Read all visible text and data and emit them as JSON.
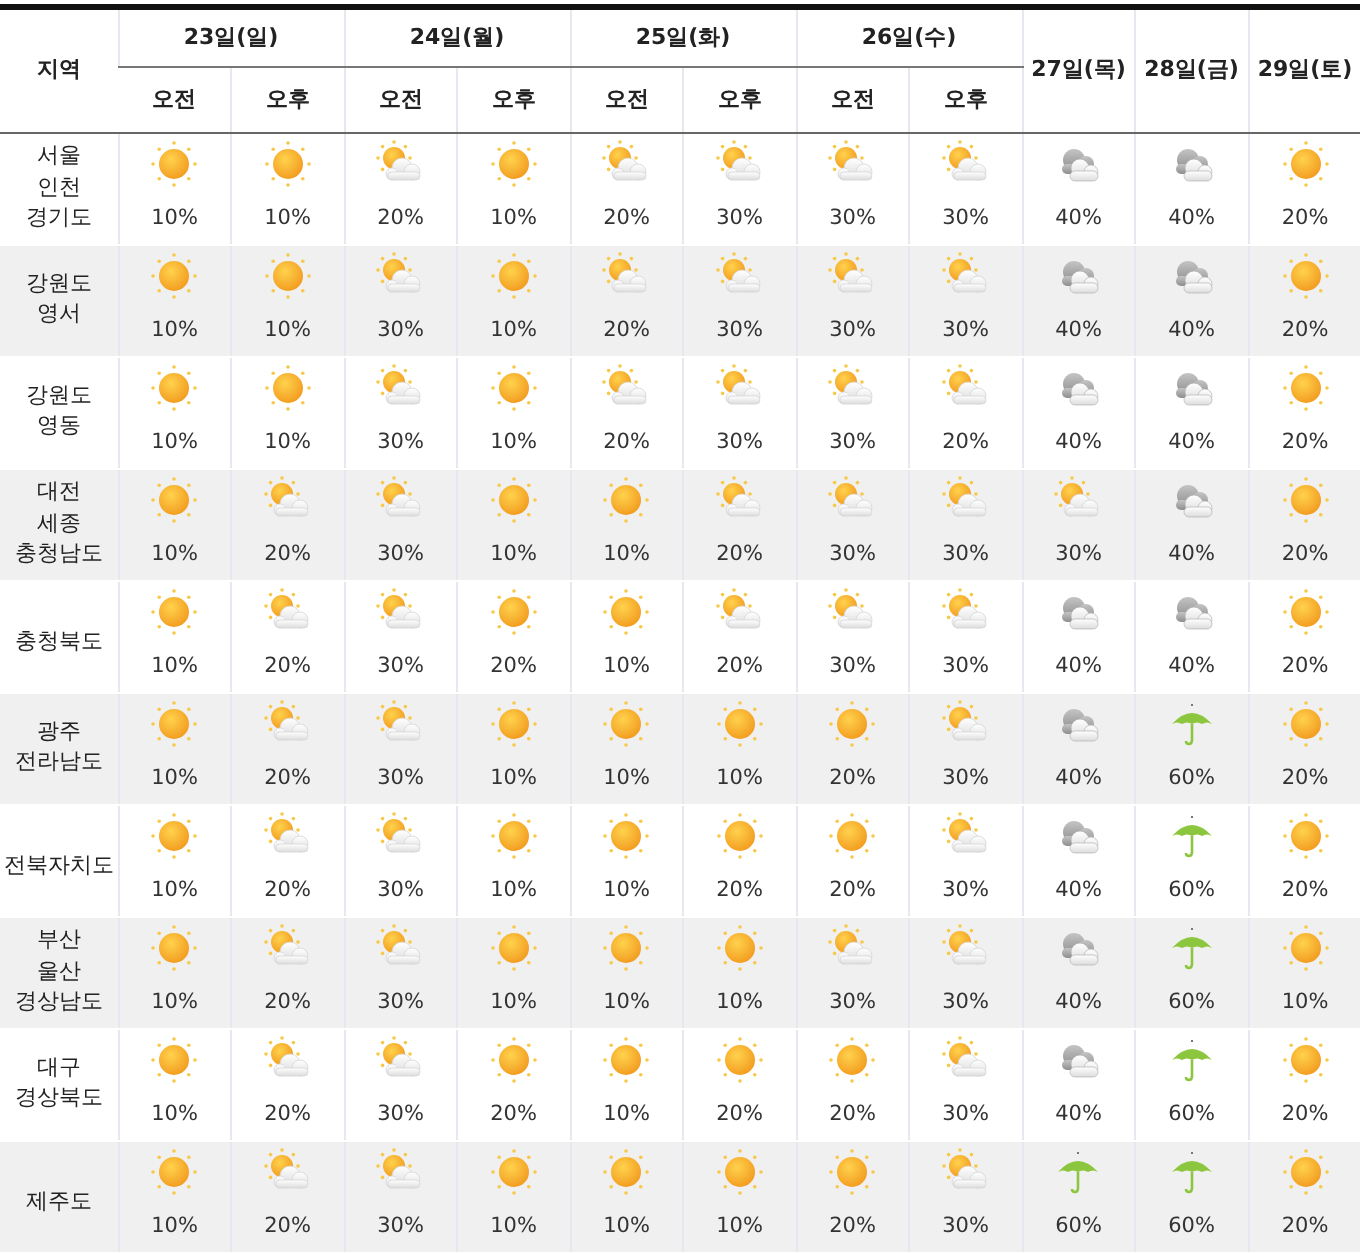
{
  "table": {
    "corner_header": "지역",
    "days": [
      {
        "label": "23일(일)",
        "periods": [
          "오전",
          "오후"
        ]
      },
      {
        "label": "24일(월)",
        "periods": [
          "오전",
          "오후"
        ]
      },
      {
        "label": "25일(화)",
        "periods": [
          "오전",
          "오후"
        ]
      },
      {
        "label": "26일(수)",
        "periods": [
          "오전",
          "오후"
        ]
      },
      {
        "label": "27일(목)"
      },
      {
        "label": "28일(금)"
      },
      {
        "label": "29일(토)"
      }
    ],
    "rows": [
      {
        "region": [
          "서울",
          "인천",
          "경기도"
        ],
        "forecasts": [
          {
            "kind": "sunny",
            "chance": "10%"
          },
          {
            "kind": "sunny",
            "chance": "10%"
          },
          {
            "kind": "partly_cloudy",
            "chance": "20%"
          },
          {
            "kind": "sunny",
            "chance": "10%"
          },
          {
            "kind": "partly_cloudy",
            "chance": "20%"
          },
          {
            "kind": "partly_cloudy",
            "chance": "30%"
          },
          {
            "kind": "partly_cloudy",
            "chance": "30%"
          },
          {
            "kind": "partly_cloudy",
            "chance": "30%"
          },
          {
            "kind": "cloudy",
            "chance": "40%"
          },
          {
            "kind": "cloudy",
            "chance": "40%"
          },
          {
            "kind": "sunny",
            "chance": "20%"
          }
        ]
      },
      {
        "region": [
          "강원도",
          "영서"
        ],
        "forecasts": [
          {
            "kind": "sunny",
            "chance": "10%"
          },
          {
            "kind": "sunny",
            "chance": "10%"
          },
          {
            "kind": "partly_cloudy",
            "chance": "30%"
          },
          {
            "kind": "sunny",
            "chance": "10%"
          },
          {
            "kind": "partly_cloudy",
            "chance": "20%"
          },
          {
            "kind": "partly_cloudy",
            "chance": "30%"
          },
          {
            "kind": "partly_cloudy",
            "chance": "30%"
          },
          {
            "kind": "partly_cloudy",
            "chance": "30%"
          },
          {
            "kind": "cloudy",
            "chance": "40%"
          },
          {
            "kind": "cloudy",
            "chance": "40%"
          },
          {
            "kind": "sunny",
            "chance": "20%"
          }
        ]
      },
      {
        "region": [
          "강원도",
          "영동"
        ],
        "forecasts": [
          {
            "kind": "sunny",
            "chance": "10%"
          },
          {
            "kind": "sunny",
            "chance": "10%"
          },
          {
            "kind": "partly_cloudy",
            "chance": "30%"
          },
          {
            "kind": "sunny",
            "chance": "10%"
          },
          {
            "kind": "partly_cloudy",
            "chance": "20%"
          },
          {
            "kind": "partly_cloudy",
            "chance": "30%"
          },
          {
            "kind": "partly_cloudy",
            "chance": "30%"
          },
          {
            "kind": "partly_cloudy",
            "chance": "20%"
          },
          {
            "kind": "cloudy",
            "chance": "40%"
          },
          {
            "kind": "cloudy",
            "chance": "40%"
          },
          {
            "kind": "sunny",
            "chance": "20%"
          }
        ]
      },
      {
        "region": [
          "대전",
          "세종",
          "충청남도"
        ],
        "forecasts": [
          {
            "kind": "sunny",
            "chance": "10%"
          },
          {
            "kind": "partly_cloudy",
            "chance": "20%"
          },
          {
            "kind": "partly_cloudy",
            "chance": "30%"
          },
          {
            "kind": "sunny",
            "chance": "10%"
          },
          {
            "kind": "sunny",
            "chance": "10%"
          },
          {
            "kind": "partly_cloudy",
            "chance": "20%"
          },
          {
            "kind": "partly_cloudy",
            "chance": "30%"
          },
          {
            "kind": "partly_cloudy",
            "chance": "30%"
          },
          {
            "kind": "partly_cloudy",
            "chance": "30%"
          },
          {
            "kind": "cloudy",
            "chance": "40%"
          },
          {
            "kind": "sunny",
            "chance": "20%"
          }
        ]
      },
      {
        "region": [
          "충청북도"
        ],
        "forecasts": [
          {
            "kind": "sunny",
            "chance": "10%"
          },
          {
            "kind": "partly_cloudy",
            "chance": "20%"
          },
          {
            "kind": "partly_cloudy",
            "chance": "30%"
          },
          {
            "kind": "sunny",
            "chance": "20%"
          },
          {
            "kind": "sunny",
            "chance": "10%"
          },
          {
            "kind": "partly_cloudy",
            "chance": "20%"
          },
          {
            "kind": "partly_cloudy",
            "chance": "30%"
          },
          {
            "kind": "partly_cloudy",
            "chance": "30%"
          },
          {
            "kind": "cloudy",
            "chance": "40%"
          },
          {
            "kind": "cloudy",
            "chance": "40%"
          },
          {
            "kind": "sunny",
            "chance": "20%"
          }
        ]
      },
      {
        "region": [
          "광주",
          "전라남도"
        ],
        "forecasts": [
          {
            "kind": "sunny",
            "chance": "10%"
          },
          {
            "kind": "partly_cloudy",
            "chance": "20%"
          },
          {
            "kind": "partly_cloudy",
            "chance": "30%"
          },
          {
            "kind": "sunny",
            "chance": "10%"
          },
          {
            "kind": "sunny",
            "chance": "10%"
          },
          {
            "kind": "sunny",
            "chance": "10%"
          },
          {
            "kind": "sunny",
            "chance": "20%"
          },
          {
            "kind": "partly_cloudy",
            "chance": "30%"
          },
          {
            "kind": "cloudy",
            "chance": "40%"
          },
          {
            "kind": "rain",
            "chance": "60%"
          },
          {
            "kind": "sunny",
            "chance": "20%"
          }
        ]
      },
      {
        "region": [
          "전북자치도"
        ],
        "forecasts": [
          {
            "kind": "sunny",
            "chance": "10%"
          },
          {
            "kind": "partly_cloudy",
            "chance": "20%"
          },
          {
            "kind": "partly_cloudy",
            "chance": "30%"
          },
          {
            "kind": "sunny",
            "chance": "10%"
          },
          {
            "kind": "sunny",
            "chance": "10%"
          },
          {
            "kind": "sunny",
            "chance": "20%"
          },
          {
            "kind": "sunny",
            "chance": "20%"
          },
          {
            "kind": "partly_cloudy",
            "chance": "30%"
          },
          {
            "kind": "cloudy",
            "chance": "40%"
          },
          {
            "kind": "rain",
            "chance": "60%"
          },
          {
            "kind": "sunny",
            "chance": "20%"
          }
        ]
      },
      {
        "region": [
          "부산",
          "울산",
          "경상남도"
        ],
        "forecasts": [
          {
            "kind": "sunny",
            "chance": "10%"
          },
          {
            "kind": "partly_cloudy",
            "chance": "20%"
          },
          {
            "kind": "partly_cloudy",
            "chance": "30%"
          },
          {
            "kind": "sunny",
            "chance": "10%"
          },
          {
            "kind": "sunny",
            "chance": "10%"
          },
          {
            "kind": "sunny",
            "chance": "10%"
          },
          {
            "kind": "partly_cloudy",
            "chance": "30%"
          },
          {
            "kind": "partly_cloudy",
            "chance": "30%"
          },
          {
            "kind": "cloudy",
            "chance": "40%"
          },
          {
            "kind": "rain",
            "chance": "60%"
          },
          {
            "kind": "sunny",
            "chance": "10%"
          }
        ]
      },
      {
        "region": [
          "대구",
          "경상북도"
        ],
        "forecasts": [
          {
            "kind": "sunny",
            "chance": "10%"
          },
          {
            "kind": "partly_cloudy",
            "chance": "20%"
          },
          {
            "kind": "partly_cloudy",
            "chance": "30%"
          },
          {
            "kind": "sunny",
            "chance": "20%"
          },
          {
            "kind": "sunny",
            "chance": "10%"
          },
          {
            "kind": "sunny",
            "chance": "20%"
          },
          {
            "kind": "sunny",
            "chance": "20%"
          },
          {
            "kind": "partly_cloudy",
            "chance": "30%"
          },
          {
            "kind": "cloudy",
            "chance": "40%"
          },
          {
            "kind": "rain",
            "chance": "60%"
          },
          {
            "kind": "sunny",
            "chance": "20%"
          }
        ]
      },
      {
        "region": [
          "제주도"
        ],
        "forecasts": [
          {
            "kind": "sunny",
            "chance": "10%"
          },
          {
            "kind": "partly_cloudy",
            "chance": "20%"
          },
          {
            "kind": "partly_cloudy",
            "chance": "30%"
          },
          {
            "kind": "sunny",
            "chance": "10%"
          },
          {
            "kind": "sunny",
            "chance": "10%"
          },
          {
            "kind": "sunny",
            "chance": "10%"
          },
          {
            "kind": "sunny",
            "chance": "20%"
          },
          {
            "kind": "partly_cloudy",
            "chance": "30%"
          },
          {
            "kind": "rain",
            "chance": "60%"
          },
          {
            "kind": "rain",
            "chance": "60%"
          },
          {
            "kind": "sunny",
            "chance": "20%"
          }
        ]
      }
    ]
  }
}
